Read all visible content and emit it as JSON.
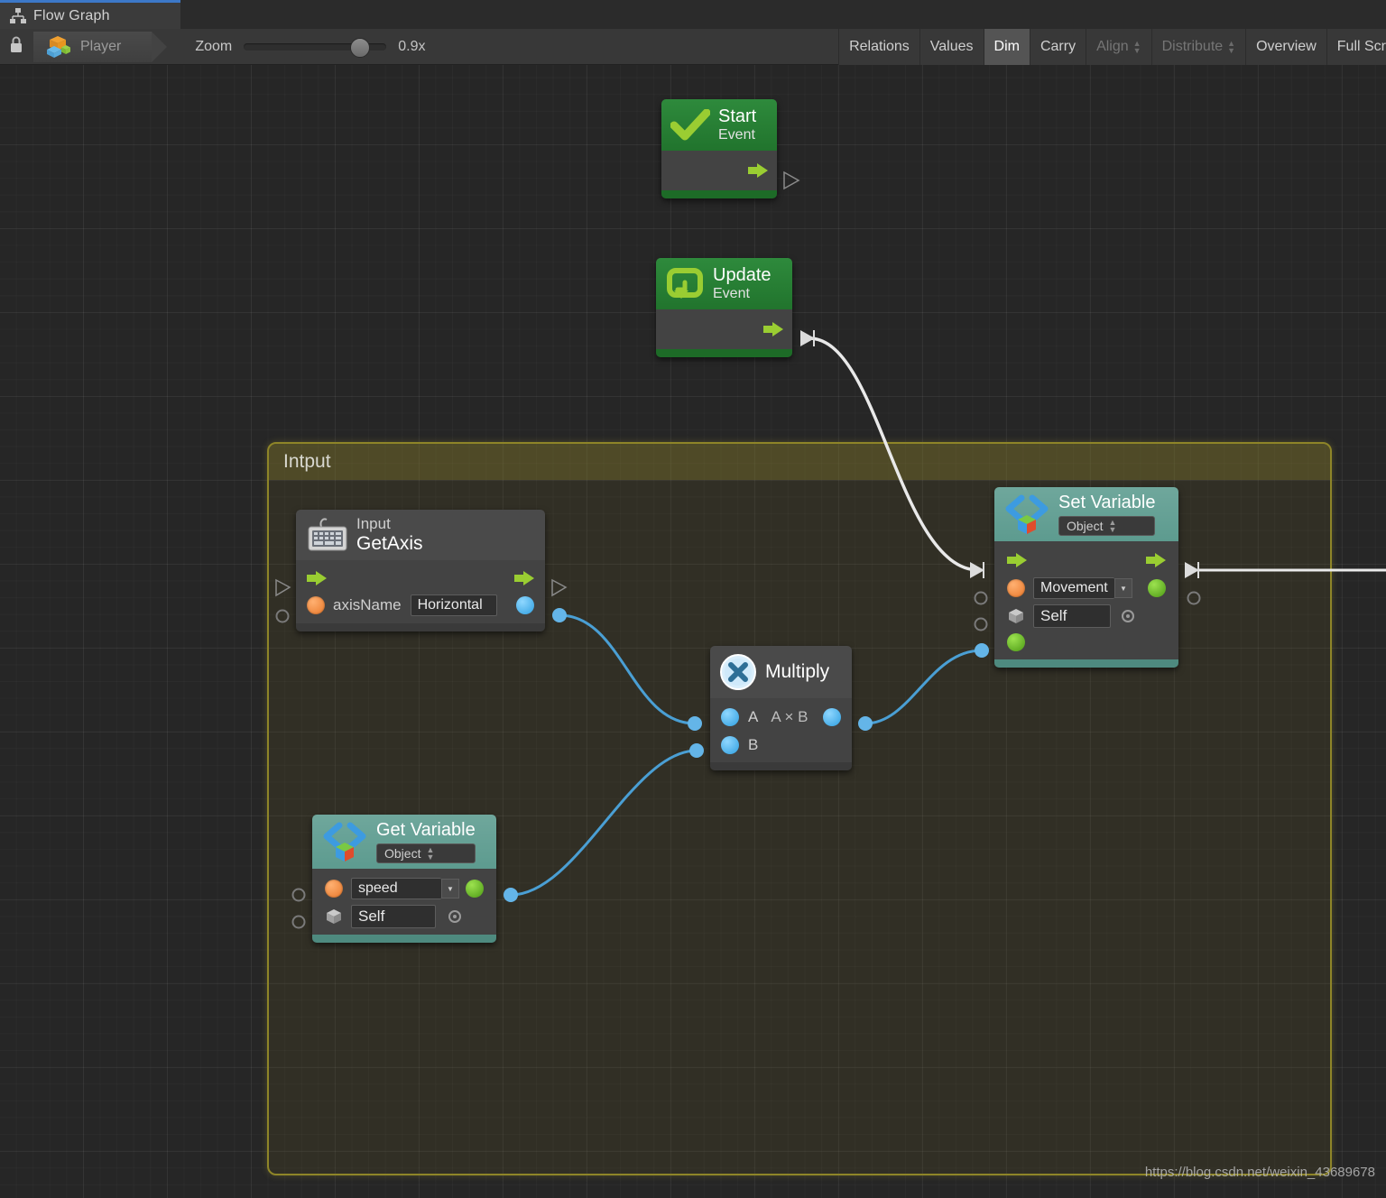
{
  "window": {
    "tab_title": "Flow Graph",
    "tab_icon": "flow-graph-icon"
  },
  "toolbar": {
    "lock_icon": "lock-icon",
    "context_button": {
      "label": "Player",
      "icon": "unity-prefab-icon"
    },
    "zoom": {
      "label": "Zoom",
      "value": "0.9x",
      "slider_percent": 81
    },
    "right_items": [
      {
        "label": "Relations",
        "state": "normal",
        "stepper": false
      },
      {
        "label": "Values",
        "state": "normal",
        "stepper": false
      },
      {
        "label": "Dim",
        "state": "active",
        "stepper": false
      },
      {
        "label": "Carry",
        "state": "normal",
        "stepper": false
      },
      {
        "label": "Align",
        "state": "disabled",
        "stepper": true
      },
      {
        "label": "Distribute",
        "state": "disabled",
        "stepper": true
      },
      {
        "label": "Overview",
        "state": "normal",
        "stepper": false
      },
      {
        "label": "Full Scr",
        "state": "normal",
        "stepper": false
      }
    ]
  },
  "group": {
    "title": "Intput"
  },
  "nodes": {
    "start_event": {
      "title": "Start",
      "subtitle": "Event",
      "icon": "checkmark-icon",
      "out_flow_port": "flow-out-port"
    },
    "update_event": {
      "title": "Update",
      "subtitle": "Event",
      "icon": "loop-icon",
      "out_flow_port": "flow-out-port"
    },
    "input_getaxis": {
      "title_top": "Input",
      "title_main": "GetAxis",
      "icon": "keyboard-icon",
      "param_label": "axisName",
      "param_value": "Horizontal"
    },
    "multiply": {
      "title": "Multiply",
      "icon": "multiply-icon",
      "input_a": "A",
      "input_b": "B",
      "output_label": "A × B"
    },
    "get_variable": {
      "title": "Get Variable",
      "type_badge": "Object",
      "variable_name": "speed",
      "target_value": "Self",
      "icon": "code-brackets-icon"
    },
    "set_variable": {
      "title": "Set Variable",
      "type_badge": "Object",
      "variable_name": "Movement",
      "target_value": "Self",
      "icon": "code-brackets-icon"
    }
  },
  "watermark": "https://blog.csdn.net/weixin_43689678"
}
